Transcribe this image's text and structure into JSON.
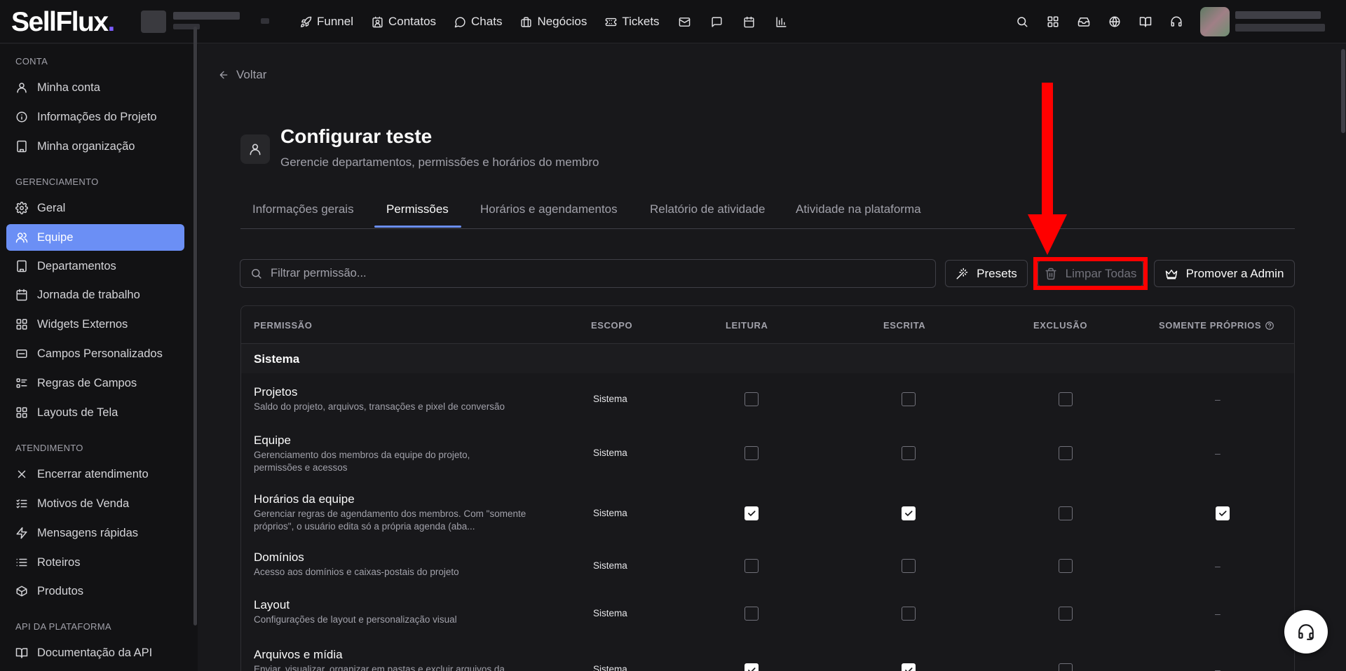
{
  "topbar": {
    "logo_text": "SellFlux",
    "logo_dot": ".",
    "nav": [
      {
        "label": "Funnel",
        "icon": "rocket-icon"
      },
      {
        "label": "Contatos",
        "icon": "contacts-icon"
      },
      {
        "label": "Chats",
        "icon": "chat-bubble-icon"
      },
      {
        "label": "Negócios",
        "icon": "briefcase-icon"
      },
      {
        "label": "Tickets",
        "icon": "ticket-icon"
      }
    ],
    "nav_icons": [
      "mail-icon",
      "message-square-icon",
      "calendar-icon",
      "bar-chart-icon"
    ],
    "right_icons": [
      "search-icon",
      "grid-icon",
      "inbox-icon",
      "globe-icon",
      "book-open-icon",
      "headset-icon"
    ]
  },
  "sidebar": {
    "sections": [
      {
        "title": "CONTA",
        "items": [
          {
            "label": "Minha conta",
            "icon": "user-icon"
          },
          {
            "label": "Informações do Projeto",
            "icon": "info-icon"
          },
          {
            "label": "Minha organização",
            "icon": "building-icon"
          }
        ]
      },
      {
        "title": "GERENCIAMENTO",
        "items": [
          {
            "label": "Geral",
            "icon": "gear-icon"
          },
          {
            "label": "Equipe",
            "icon": "users-icon",
            "active": true
          },
          {
            "label": "Departamentos",
            "icon": "building-icon"
          },
          {
            "label": "Jornada de trabalho",
            "icon": "calendar-icon"
          },
          {
            "label": "Widgets Externos",
            "icon": "widgets-icon"
          },
          {
            "label": "Campos Personalizados",
            "icon": "form-icon"
          },
          {
            "label": "Regras de Campos",
            "icon": "list-rules-icon"
          },
          {
            "label": "Layouts de Tela",
            "icon": "layout-icon"
          }
        ]
      },
      {
        "title": "ATENDIMENTO",
        "items": [
          {
            "label": "Encerrar atendimento",
            "icon": "close-icon"
          },
          {
            "label": "Motivos de Venda",
            "icon": "list-check-icon"
          },
          {
            "label": "Mensagens rápidas",
            "icon": "lightning-icon"
          },
          {
            "label": "Roteiros",
            "icon": "list-icon"
          },
          {
            "label": "Produtos",
            "icon": "box-icon"
          }
        ]
      },
      {
        "title": "API DA PLATAFORMA",
        "items": [
          {
            "label": "Documentação da API",
            "icon": "book-icon"
          }
        ]
      }
    ]
  },
  "page": {
    "back_label": "Voltar",
    "title": "Configurar teste",
    "subtitle": "Gerencie departamentos, permissões e horários do membro",
    "tabs": [
      {
        "label": "Informações gerais"
      },
      {
        "label": "Permissões",
        "active": true
      },
      {
        "label": "Horários e agendamentos"
      },
      {
        "label": "Relatório de atividade"
      },
      {
        "label": "Atividade na plataforma"
      }
    ],
    "search_placeholder": "Filtrar permissão...",
    "buttons": {
      "presets": "Presets",
      "clear_all": "Limpar Todas",
      "promote": "Promover a Admin"
    }
  },
  "table": {
    "headers": {
      "permission": "PERMISSÃO",
      "scope": "ESCOPO",
      "read": "LEITURA",
      "write": "ESCRITA",
      "delete": "EXCLUSÃO",
      "own_only": "SOMENTE PRÓPRIOS"
    },
    "group": "Sistema",
    "rows": [
      {
        "name": "Projetos",
        "desc": "Saldo do projeto, arquivos, transações e pixel de conversão",
        "scope": "Sistema",
        "read": false,
        "write": false,
        "delete": false,
        "own": "–"
      },
      {
        "name": "Equipe",
        "desc": "Gerenciamento dos membros da equipe do projeto, permissões e acessos",
        "scope": "Sistema",
        "read": false,
        "write": false,
        "delete": false,
        "own": "–"
      },
      {
        "name": "Horários da equipe",
        "desc": "Gerenciar regras de agendamento dos membros. Com \"somente próprios\", o usuário edita só a própria agenda (aba...",
        "scope": "Sistema",
        "read": true,
        "write": true,
        "delete": false,
        "own": true
      },
      {
        "name": "Domínios",
        "desc": "Acesso aos domínios e caixas-postais do projeto",
        "scope": "Sistema",
        "read": false,
        "write": false,
        "delete": false,
        "own": "–"
      },
      {
        "name": "Layout",
        "desc": "Configurações de layout e personalização visual",
        "scope": "Sistema",
        "read": false,
        "write": false,
        "delete": false,
        "own": "–"
      },
      {
        "name": "Arquivos e mídia",
        "desc": "Enviar, visualizar, organizar em pastas e excluir arquivos da",
        "scope": "Sistema",
        "read": true,
        "write": true,
        "delete": false,
        "own": "–"
      }
    ]
  },
  "colors": {
    "accent": "#6b8ff5",
    "highlight": "#ff0000",
    "background": "#18181b"
  }
}
